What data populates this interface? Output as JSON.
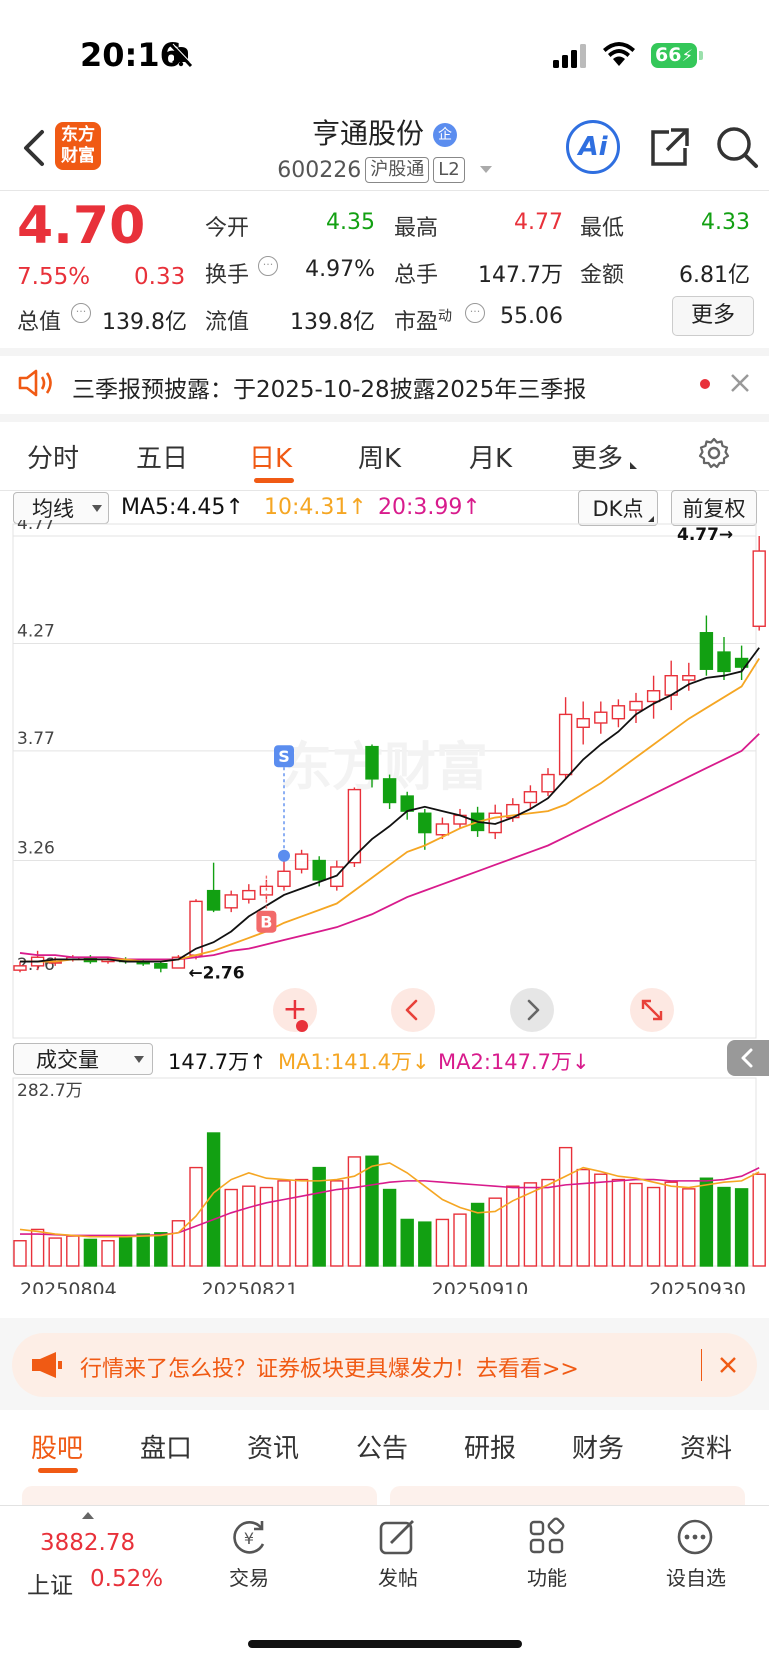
{
  "status": {
    "time": "20:16",
    "battery": "66"
  },
  "header": {
    "back_label": "<",
    "logo_line1": "东方",
    "logo_line2": "财富",
    "title": "亨通股份",
    "title_badge": "企",
    "code": "600226",
    "tag1": "沪股通",
    "tag2": "L2",
    "ai_label": "Ai"
  },
  "quote": {
    "price": "4.70",
    "change_pct": "7.55%",
    "change_amt": "0.33",
    "rows": [
      [
        {
          "label": "今开",
          "value": "4.35",
          "color": "green"
        },
        {
          "label": "最高",
          "value": "4.77",
          "color": "red"
        },
        {
          "label": "最低",
          "value": "4.33",
          "color": "green"
        }
      ],
      [
        {
          "label": "换手",
          "value": "4.97%",
          "color": "black"
        },
        {
          "label": "总手",
          "value": "147.7万",
          "color": "black"
        },
        {
          "label": "金额",
          "value": "6.81亿",
          "color": "black"
        }
      ]
    ],
    "total_value_label": "总值",
    "total_value": "139.8亿",
    "float_value_label": "流值",
    "float_value": "139.8亿",
    "pe_label": "市盈",
    "pe_sup": "动",
    "pe_value": "55.06",
    "more_button": "更多"
  },
  "notice": {
    "text": "三季报预披露：于2025-10-28披露2025年三季报"
  },
  "tabs": [
    "分时",
    "五日",
    "日K",
    "周K",
    "月K",
    "更多"
  ],
  "active_tab": 2,
  "ma_bar": {
    "selector": "均线",
    "ma5": "MA5:4.45",
    "ma10": "10:4.31",
    "ma20": "20:3.99",
    "dk_button": "DK点",
    "fq_button": "前复权"
  },
  "price_axis": [
    "4.77",
    "4.27",
    "3.77",
    "3.26",
    "2.76"
  ],
  "markers": {
    "high": "4.77",
    "low": "2.76",
    "sell": "S",
    "buy": "B"
  },
  "volume_bar": {
    "selector": "成交量",
    "vol": "147.7万",
    "ma1": "MA1:141.4万",
    "ma2": "MA2:147.7万",
    "max_label": "282.7万"
  },
  "dates": [
    "20250804",
    "20250821",
    "20250910",
    "20250930"
  ],
  "promo": {
    "text": "行情来了怎么投？证券板块更具爆发力！去看看>>"
  },
  "sub_tabs": [
    "股吧",
    "盘口",
    "资讯",
    "公告",
    "研报",
    "财务",
    "资料"
  ],
  "bottom_nav": {
    "index_value": "3882.78",
    "index_name": "上证",
    "index_pct": "0.52%",
    "items": [
      "交易",
      "发帖",
      "功能",
      "设自选"
    ]
  },
  "colors": {
    "up": "#e8313a",
    "down": "#12a012",
    "accent": "#f05a14",
    "ma5": "#111111",
    "ma10": "#f5a623",
    "ma20": "#d81b8c"
  },
  "chart_data": {
    "type": "candlestick",
    "ylim": [
      2.76,
      4.77
    ],
    "candles": [
      {
        "o": 2.75,
        "c": 2.77,
        "h": 2.79,
        "l": 2.74
      },
      {
        "o": 2.77,
        "c": 2.81,
        "h": 2.84,
        "l": 2.75
      },
      {
        "o": 2.79,
        "c": 2.79,
        "h": 2.81,
        "l": 2.77
      },
      {
        "o": 2.8,
        "c": 2.81,
        "h": 2.82,
        "l": 2.79
      },
      {
        "o": 2.81,
        "c": 2.79,
        "h": 2.82,
        "l": 2.78
      },
      {
        "o": 2.79,
        "c": 2.8,
        "h": 2.81,
        "l": 2.78
      },
      {
        "o": 2.8,
        "c": 2.79,
        "h": 2.81,
        "l": 2.78
      },
      {
        "o": 2.79,
        "c": 2.78,
        "h": 2.8,
        "l": 2.77
      },
      {
        "o": 2.78,
        "c": 2.76,
        "h": 2.79,
        "l": 2.74
      },
      {
        "o": 2.76,
        "c": 2.81,
        "h": 2.82,
        "l": 2.76
      },
      {
        "o": 2.82,
        "c": 3.07,
        "h": 3.08,
        "l": 2.8
      },
      {
        "o": 3.12,
        "c": 3.03,
        "h": 3.25,
        "l": 3.02
      },
      {
        "o": 3.04,
        "c": 3.1,
        "h": 3.12,
        "l": 3.02
      },
      {
        "o": 3.08,
        "c": 3.12,
        "h": 3.15,
        "l": 3.06
      },
      {
        "o": 3.1,
        "c": 3.14,
        "h": 3.17,
        "l": 3.08
      },
      {
        "o": 3.14,
        "c": 3.21,
        "h": 3.26,
        "l": 3.12
      },
      {
        "o": 3.22,
        "c": 3.29,
        "h": 3.31,
        "l": 3.2
      },
      {
        "o": 3.26,
        "c": 3.17,
        "h": 3.28,
        "l": 3.14
      },
      {
        "o": 3.14,
        "c": 3.23,
        "h": 3.26,
        "l": 3.12
      },
      {
        "o": 3.25,
        "c": 3.59,
        "h": 3.6,
        "l": 3.23
      },
      {
        "o": 3.79,
        "c": 3.64,
        "h": 3.8,
        "l": 3.6
      },
      {
        "o": 3.64,
        "c": 3.53,
        "h": 3.66,
        "l": 3.5
      },
      {
        "o": 3.56,
        "c": 3.49,
        "h": 3.58,
        "l": 3.45
      },
      {
        "o": 3.48,
        "c": 3.39,
        "h": 3.5,
        "l": 3.31
      },
      {
        "o": 3.38,
        "c": 3.43,
        "h": 3.46,
        "l": 3.36
      },
      {
        "o": 3.43,
        "c": 3.47,
        "h": 3.5,
        "l": 3.41
      },
      {
        "o": 3.48,
        "c": 3.4,
        "h": 3.51,
        "l": 3.37
      },
      {
        "o": 3.39,
        "c": 3.48,
        "h": 3.52,
        "l": 3.36
      },
      {
        "o": 3.46,
        "c": 3.52,
        "h": 3.55,
        "l": 3.44
      },
      {
        "o": 3.53,
        "c": 3.58,
        "h": 3.61,
        "l": 3.5
      },
      {
        "o": 3.58,
        "c": 3.66,
        "h": 3.69,
        "l": 3.56
      },
      {
        "o": 3.66,
        "c": 3.94,
        "h": 4.02,
        "l": 3.64
      },
      {
        "o": 3.88,
        "c": 3.92,
        "h": 4.0,
        "l": 3.8
      },
      {
        "o": 3.9,
        "c": 3.95,
        "h": 4.0,
        "l": 3.85
      },
      {
        "o": 3.92,
        "c": 3.98,
        "h": 4.01,
        "l": 3.88
      },
      {
        "o": 3.96,
        "c": 4.0,
        "h": 4.04,
        "l": 3.9
      },
      {
        "o": 4.0,
        "c": 4.05,
        "h": 4.12,
        "l": 3.92
      },
      {
        "o": 4.03,
        "c": 4.12,
        "h": 4.19,
        "l": 3.96
      },
      {
        "o": 4.1,
        "c": 4.12,
        "h": 4.18,
        "l": 4.05
      },
      {
        "o": 4.32,
        "c": 4.15,
        "h": 4.4,
        "l": 4.12
      },
      {
        "o": 4.23,
        "c": 4.14,
        "h": 4.3,
        "l": 4.1
      },
      {
        "o": 4.2,
        "c": 4.16,
        "h": 4.26,
        "l": 4.1
      },
      {
        "o": 4.35,
        "c": 4.7,
        "h": 4.77,
        "l": 4.33
      }
    ],
    "ma5": [
      2.79,
      2.79,
      2.8,
      2.8,
      2.8,
      2.8,
      2.79,
      2.79,
      2.79,
      2.8,
      2.85,
      2.88,
      2.93,
      3.0,
      3.05,
      3.1,
      3.13,
      3.16,
      3.19,
      3.28,
      3.36,
      3.42,
      3.49,
      3.51,
      3.49,
      3.47,
      3.44,
      3.43,
      3.46,
      3.5,
      3.55,
      3.64,
      3.73,
      3.8,
      3.86,
      3.94,
      3.99,
      4.03,
      4.08,
      4.11,
      4.12,
      4.14,
      4.25
    ],
    "ma10": [
      2.79,
      2.79,
      2.79,
      2.8,
      2.8,
      2.8,
      2.8,
      2.79,
      2.79,
      2.8,
      2.82,
      2.84,
      2.87,
      2.9,
      2.93,
      2.97,
      3.0,
      3.03,
      3.06,
      3.12,
      3.18,
      3.24,
      3.3,
      3.33,
      3.37,
      3.41,
      3.44,
      3.46,
      3.47,
      3.48,
      3.49,
      3.52,
      3.57,
      3.62,
      3.68,
      3.74,
      3.8,
      3.86,
      3.92,
      3.97,
      4.02,
      4.07,
      4.2
    ],
    "ma20": [
      2.83,
      2.82,
      2.82,
      2.81,
      2.81,
      2.81,
      2.8,
      2.8,
      2.8,
      2.8,
      2.81,
      2.82,
      2.84,
      2.85,
      2.87,
      2.89,
      2.91,
      2.93,
      2.95,
      2.98,
      3.01,
      3.05,
      3.09,
      3.12,
      3.15,
      3.18,
      3.21,
      3.24,
      3.27,
      3.3,
      3.33,
      3.37,
      3.41,
      3.45,
      3.49,
      3.53,
      3.57,
      3.61,
      3.65,
      3.69,
      3.73,
      3.77,
      3.85
    ],
    "volume": [
      38,
      55,
      42,
      45,
      40,
      38,
      44,
      48,
      50,
      68,
      148,
      200,
      115,
      120,
      118,
      128,
      130,
      148,
      128,
      164,
      165,
      115,
      70,
      66,
      70,
      78,
      94,
      102,
      120,
      125,
      130,
      178,
      145,
      138,
      130,
      124,
      118,
      126,
      116,
      132,
      118,
      116,
      138
    ],
    "vol_ma1": [
      55,
      52,
      48,
      46,
      44,
      44,
      44,
      45,
      46,
      50,
      75,
      110,
      130,
      140,
      132,
      130,
      128,
      128,
      130,
      135,
      150,
      155,
      140,
      120,
      100,
      88,
      80,
      82,
      98,
      110,
      122,
      135,
      148,
      142,
      135,
      132,
      126,
      120,
      118,
      122,
      126,
      128,
      141.4
    ],
    "vol_ma2": [
      48,
      48,
      47,
      46,
      46,
      46,
      46,
      46,
      47,
      50,
      60,
      70,
      80,
      88,
      95,
      100,
      105,
      110,
      115,
      118,
      122,
      126,
      128,
      128,
      126,
      124,
      122,
      120,
      118,
      118,
      118,
      122,
      124,
      126,
      128,
      130,
      130,
      128,
      128,
      128,
      130,
      135,
      147.7
    ],
    "vol_max": 282.7
  }
}
